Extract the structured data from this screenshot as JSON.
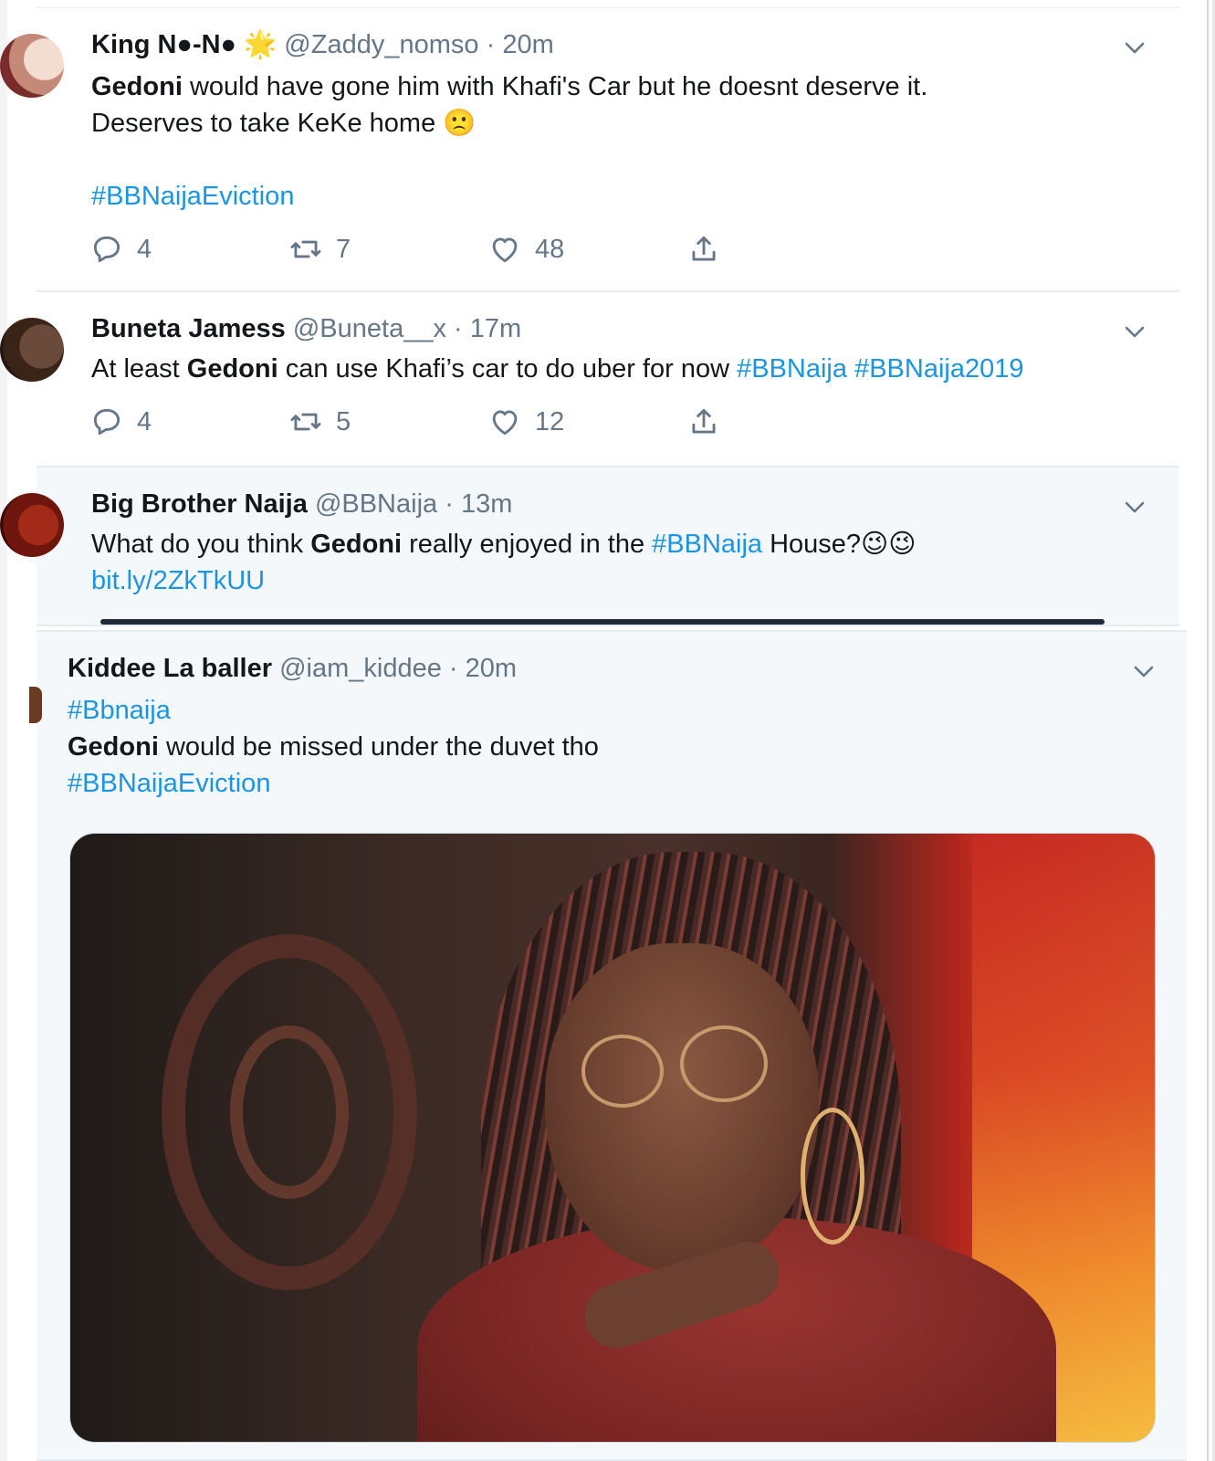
{
  "colors": {
    "link": "#1b95e0",
    "muted": "#657786",
    "text": "#14171a"
  },
  "tweets": [
    {
      "name": "King N●-N●",
      "badge": "🌟",
      "handle": "@Zaddy_nomso",
      "sep": "·",
      "time": "20m",
      "bold": "Gedoni",
      "line1_rest": " would have gone him with Khafi's Car but he doesnt deserve it.",
      "line2": "Deserves to take KeKe home 🙁",
      "hashtag": "#BBNaijaEviction",
      "replies": "4",
      "retweets": "7",
      "likes": "48"
    },
    {
      "name": "Buneta Jamess",
      "handle": "@Buneta__x",
      "sep": "·",
      "time": "17m",
      "pre": "At least ",
      "bold": "Gedoni",
      "rest": " can use Khafi’s car to do uber for now ",
      "tag1": "#BBNaija",
      "tag2": "#BBNaija2019",
      "replies": "4",
      "retweets": "5",
      "likes": "12"
    },
    {
      "name": "Big Brother Naija",
      "handle": "@BBNaija",
      "sep": "·",
      "time": "13m",
      "pre": "What do you think ",
      "bold": "Gedoni",
      "mid": " really enjoyed in the ",
      "tag": "#BBNaija",
      "post": " House?😉😉",
      "link": "bit.ly/2ZkTkUU"
    },
    {
      "name": "Kiddee La baller",
      "handle": "@iam_kiddee",
      "sep": "·",
      "time": "20m",
      "tag_top": "#Bbnaija",
      "bold": "Gedoni",
      "rest": " would be missed under the duvet tho",
      "tag_bottom": "#BBNaijaEviction"
    }
  ],
  "icons": {
    "reply": "reply-icon",
    "retweet": "retweet-icon",
    "like": "heart-icon",
    "share": "share-icon",
    "more": "chevron-down-icon"
  }
}
